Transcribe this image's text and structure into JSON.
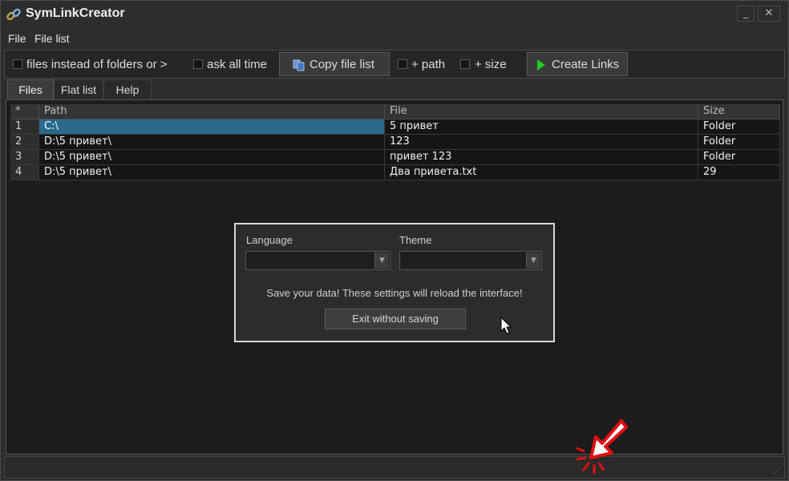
{
  "app": {
    "title": "SymLinkCreator",
    "icon": "chain-link-icon"
  },
  "window_buttons": {
    "minimize": "_",
    "close": "✕"
  },
  "menu": [
    {
      "label": "File"
    },
    {
      "label": "File list"
    }
  ],
  "toolbar": {
    "files_instead_label": "files instead of folders or >",
    "ask_all_time_label": "ask all time",
    "copy_file_list_label": "Copy file list",
    "plus_path_label": "+ path",
    "plus_size_label": "+ size",
    "create_links_label": "Create Links"
  },
  "tabs": [
    {
      "label": "Files",
      "active": true
    },
    {
      "label": "Flat list",
      "active": false
    },
    {
      "label": "Help",
      "active": false
    }
  ],
  "grid": {
    "columns": [
      "*",
      "Path",
      "File",
      "Size"
    ],
    "rows": [
      {
        "idx": "1",
        "path": "C:\\",
        "file": "5 привет",
        "size": "Folder"
      },
      {
        "idx": "2",
        "path": "D:\\5 привет\\",
        "file": "123",
        "size": "Folder"
      },
      {
        "idx": "3",
        "path": "D:\\5 привет\\",
        "file": "привет 123",
        "size": "Folder"
      },
      {
        "idx": "4",
        "path": "D:\\5 привет\\",
        "file": "Два привета.txt",
        "size": "29"
      }
    ]
  },
  "settings_dialog": {
    "language_label": "Language",
    "theme_label": "Theme",
    "language_value": "",
    "theme_value": "",
    "message": "Save your data! These settings will reload the interface!",
    "exit_button": "Exit without saving"
  },
  "colors": {
    "selection": "#2a6a8a",
    "create_links_arrow": "#22cc22",
    "click_marker": "#e01010"
  }
}
